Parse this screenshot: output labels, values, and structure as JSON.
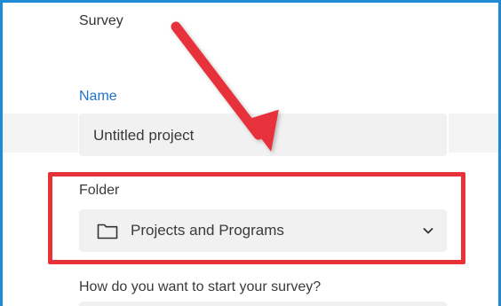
{
  "survey": {
    "section_title": "Survey",
    "name_label": "Name",
    "name_value": "Untitled project",
    "folder_label": "Folder",
    "folder_value": "Projects and Programs",
    "folder_icon": "folder-icon",
    "dropdown_icon": "chevron-down-icon",
    "start_question": "How do you want to start your survey?"
  },
  "colors": {
    "frame_border": "#1f8ad6",
    "name_label": "#1f73c9",
    "annotation_red": "#e8323a"
  }
}
